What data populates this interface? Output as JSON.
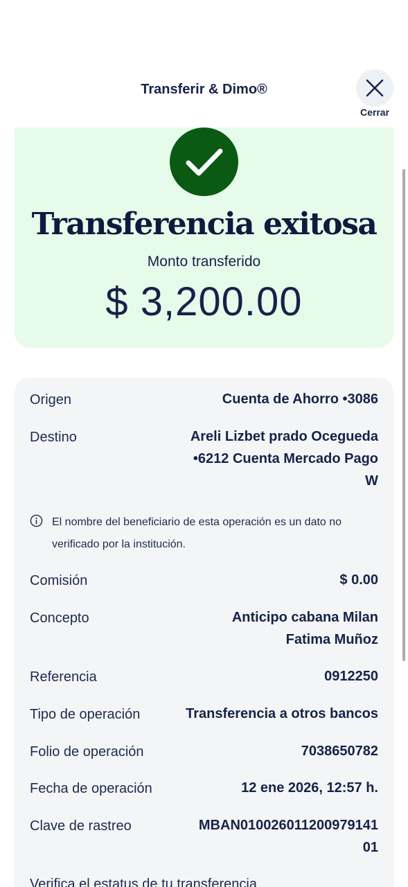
{
  "header": {
    "title": "Transferir & Dimo®",
    "close_label": "Cerrar",
    "close_icon": "close-icon"
  },
  "success": {
    "icon": "check-icon",
    "title": "Transferencia exitosa",
    "amount_label": "Monto transferido",
    "amount": "$ 3,200.00"
  },
  "details": {
    "origen": {
      "label": "Origen",
      "value": "Cuenta de Ahorro •3086"
    },
    "destino": {
      "label": "Destino",
      "value_line1": "Areli Lizbet prado Ocegueda",
      "value_line2": "•6212 Cuenta Mercado Pago",
      "value_line3": "W"
    },
    "notice": {
      "icon": "info-icon",
      "line1": "El nombre del beneficiario de esta operación es un dato no",
      "line2": "verificado por la institución."
    },
    "comision": {
      "label": "Comisión",
      "value": "$ 0.00"
    },
    "concepto": {
      "label": "Concepto",
      "value_line1": "Anticipo cabana Milan",
      "value_line2": "Fatima Muñoz"
    },
    "referencia": {
      "label": "Referencia",
      "value": "0912250"
    },
    "tipo": {
      "label": "Tipo de operación",
      "value": "Transferencia a otros bancos"
    },
    "folio": {
      "label": "Folio de operación",
      "value": "7038650782"
    },
    "fecha": {
      "label": "Fecha de operación",
      "value": "12 ene 2026, 12:57 h."
    },
    "clave": {
      "label": "Clave de rastreo",
      "value_line1": "MBAN010026011200979141",
      "value_line2": "01"
    },
    "verify_text": "Verifica el estatus de tu transferencia"
  },
  "colors": {
    "navy": "#16224a",
    "success_bg": "#e7fbea",
    "success_green": "#0a5a14",
    "card_bg": "#f4f5f6"
  }
}
